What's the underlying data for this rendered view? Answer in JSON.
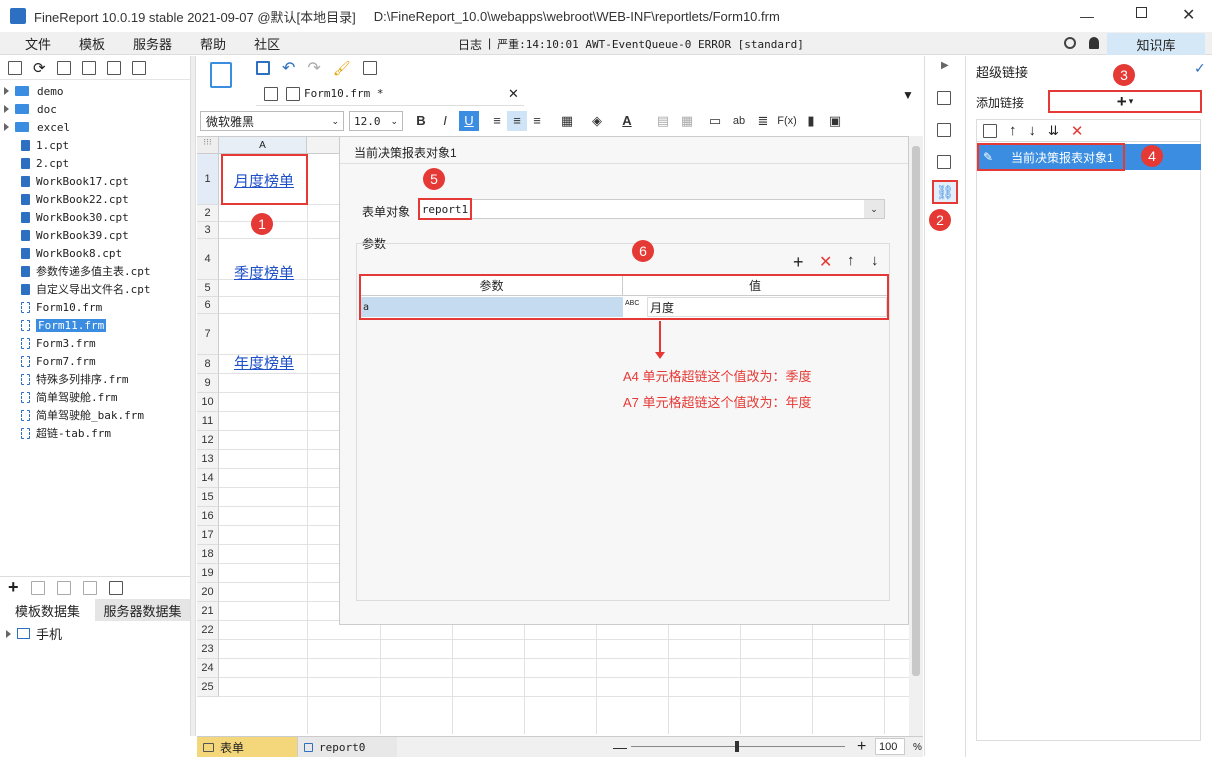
{
  "window": {
    "title": "FineReport 10.0.19 stable 2021-09-07 @默认[本地目录]",
    "path": "D:\\FineReport_10.0\\webapps\\webroot\\WEB-INF\\reportlets/Form10.frm"
  },
  "menu": [
    "文件",
    "模板",
    "服务器",
    "帮助",
    "社区"
  ],
  "log": {
    "label": "日志",
    "separator": "|",
    "text": "严重:14:10:01 AWT-EventQueue-0 ERROR [standard]"
  },
  "knowledge_label": "知识库",
  "file_tree": [
    {
      "name": "demo",
      "type": "folder"
    },
    {
      "name": "doc",
      "type": "folder"
    },
    {
      "name": "excel",
      "type": "folder"
    },
    {
      "name": "1.cpt",
      "type": "cpt"
    },
    {
      "name": "2.cpt",
      "type": "cpt"
    },
    {
      "name": "WorkBook17.cpt",
      "type": "cpt"
    },
    {
      "name": "WorkBook22.cpt",
      "type": "cpt"
    },
    {
      "name": "WorkBook30.cpt",
      "type": "cpt"
    },
    {
      "name": "WorkBook39.cpt",
      "type": "cpt"
    },
    {
      "name": "WorkBook8.cpt",
      "type": "cpt"
    },
    {
      "name": "参数传递多值主表.cpt",
      "type": "cpt"
    },
    {
      "name": "自定义导出文件名.cpt",
      "type": "cpt"
    },
    {
      "name": "Form10.frm",
      "type": "frm"
    },
    {
      "name": "Form11.frm",
      "type": "frm",
      "selected": true
    },
    {
      "name": "Form3.frm",
      "type": "frm"
    },
    {
      "name": "Form7.frm",
      "type": "frm"
    },
    {
      "name": "特殊多列排序.frm",
      "type": "frm"
    },
    {
      "name": "简单驾驶舱.frm",
      "type": "frm"
    },
    {
      "name": "简单驾驶舱_bak.frm",
      "type": "frm"
    },
    {
      "name": "超链-tab.frm",
      "type": "frm"
    }
  ],
  "dataset_tabs": {
    "template": "模板数据集",
    "server": "服务器数据集"
  },
  "dataset_item": "手机",
  "editor_tab": "Form10.frm *",
  "font": {
    "family": "微软雅黑",
    "size": "12.0"
  },
  "column_header": "A",
  "row_numbers": [
    "1",
    "2",
    "3",
    "4",
    "5",
    "6",
    "7",
    "8",
    "9",
    "10",
    "11",
    "12",
    "13",
    "14",
    "15",
    "16",
    "17",
    "18",
    "19",
    "20",
    "21",
    "22",
    "23",
    "24",
    "25"
  ],
  "cells": {
    "a1": "月度榜单",
    "a4": "季度榜单",
    "a7": "年度榜单"
  },
  "dialog": {
    "title": "当前决策报表对象1",
    "form_object_label": "表单对象",
    "form_object_value": "report1",
    "params_label": "参数",
    "table_headers": [
      "参数",
      "值"
    ],
    "row": {
      "param": "a",
      "value": "月度",
      "type_icon": "ABC"
    },
    "notes": [
      "A4 单元格超链这个值改为：季度",
      "A7 单元格超链这个值改为：年度"
    ]
  },
  "right_panel": {
    "title": "超级链接",
    "add_label": "添加链接",
    "add_button": "+",
    "link_item": "当前决策报表对象1"
  },
  "sheet_tabs": {
    "form": "表单",
    "report": "report0"
  },
  "zoom": "100",
  "zoom_unit": "%",
  "badges": [
    "1",
    "2",
    "3",
    "4",
    "5",
    "6"
  ],
  "colors": {
    "accent": "#3a8de0",
    "badge": "#e53935",
    "selected": "#3a8de0",
    "link": "#1e50c8"
  }
}
